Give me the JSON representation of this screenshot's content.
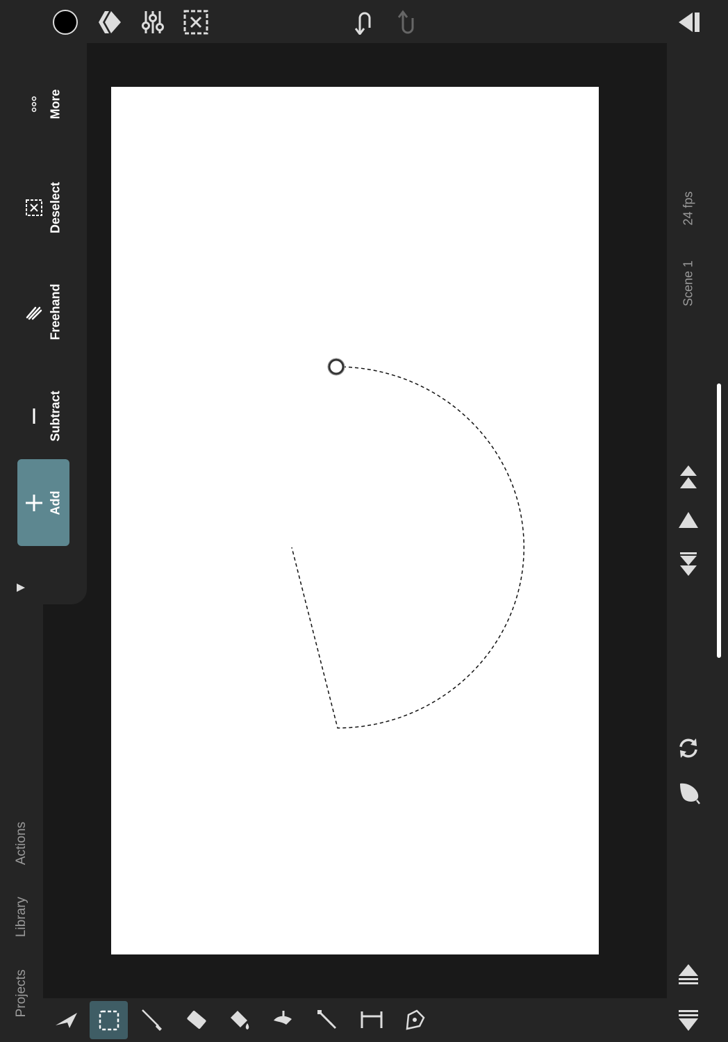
{
  "tools": {
    "more": "More",
    "deselect": "Deselect",
    "freehand": "Freehand",
    "subtract": "Subtract",
    "add": "Add"
  },
  "side_nav": {
    "actions": "Actions",
    "library": "Library",
    "projects": "Projects"
  },
  "scene": {
    "name": "Scene 1",
    "fps": "24 fps"
  },
  "colors": {
    "current_color": "#000000",
    "active_tool_bg": "#5d8790",
    "ui_bg": "#252525",
    "stage_bg": "#191919"
  },
  "top_toolbar_icons": [
    "color-swatch-icon",
    "layers-diamond-icon",
    "adjustments-sliders-icon",
    "deselect-box-icon",
    "undo-icon",
    "redo-icon",
    "collapse-panel-icon"
  ],
  "bottom_toolbar_icons": [
    "move-arrow-icon",
    "marquee-select-icon",
    "brush-icon",
    "eraser-icon",
    "fill-icon",
    "smudge-icon",
    "eyedropper-icon",
    "ruler-icon",
    "pen-icon"
  ],
  "right_panel_icons": [
    "move-to-top-icon",
    "move-up-icon",
    "move-down-icon",
    "loop-icon",
    "onion-skin-icon",
    "expand-up-icon",
    "collapse-down-icon"
  ]
}
